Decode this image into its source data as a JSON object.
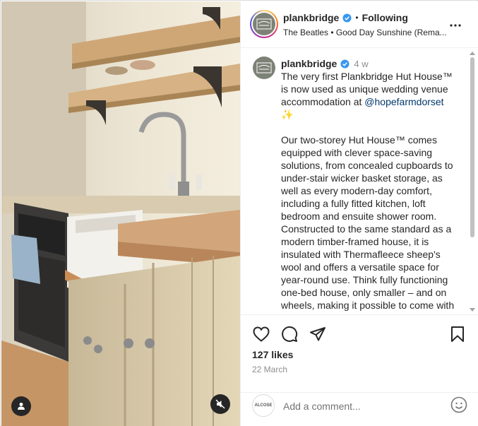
{
  "post": {
    "username": "plankbridge",
    "follow_separator": "•",
    "follow_status": "Following",
    "music": "The Beatles • Good Day Sunshine (Rema...",
    "more_label": "More options"
  },
  "caption": {
    "username": "plankbridge",
    "time": "4 w",
    "lines_para1": [
      "The very first Plankbridge Hut House™",
      "is now used as unique wedding venue",
      "accommodation at "
    ],
    "mention": "@hopefarmdorset",
    "sparkle": "✨",
    "para2": "Our two-storey Hut House™ comes equipped with clever space-saving solutions, from concealed cupboards to under-stair wicker basket storage, as well as every modern-day comfort, including a fully fitted kitchen, loft bedroom and ensuite shower room. Constructed to the same standard as a modern timber-framed house, it is insulated with Thermafleece sheep's wool and offers a versatile space for year-round use. Think fully functioning one-bed house, only smaller – and on wheels, making it possible to come with"
  },
  "engagement": {
    "likes": "127 likes",
    "date": "22 March"
  },
  "comment": {
    "placeholder": "Add a comment...",
    "avatar_text": "ALCOSE"
  },
  "icons": {
    "like": "heart-icon",
    "comment": "comment-bubble-icon",
    "share": "paper-plane-icon",
    "save": "bookmark-icon",
    "emoji": "emoji-icon",
    "more": "more-horizontal-icon",
    "verified": "verified-badge-icon",
    "mute": "speaker-muted-icon",
    "tag": "user-tag-icon"
  },
  "colors": {
    "verified": "#3897f0",
    "mention": "#00376b",
    "muted_text": "#8e8e8e"
  }
}
